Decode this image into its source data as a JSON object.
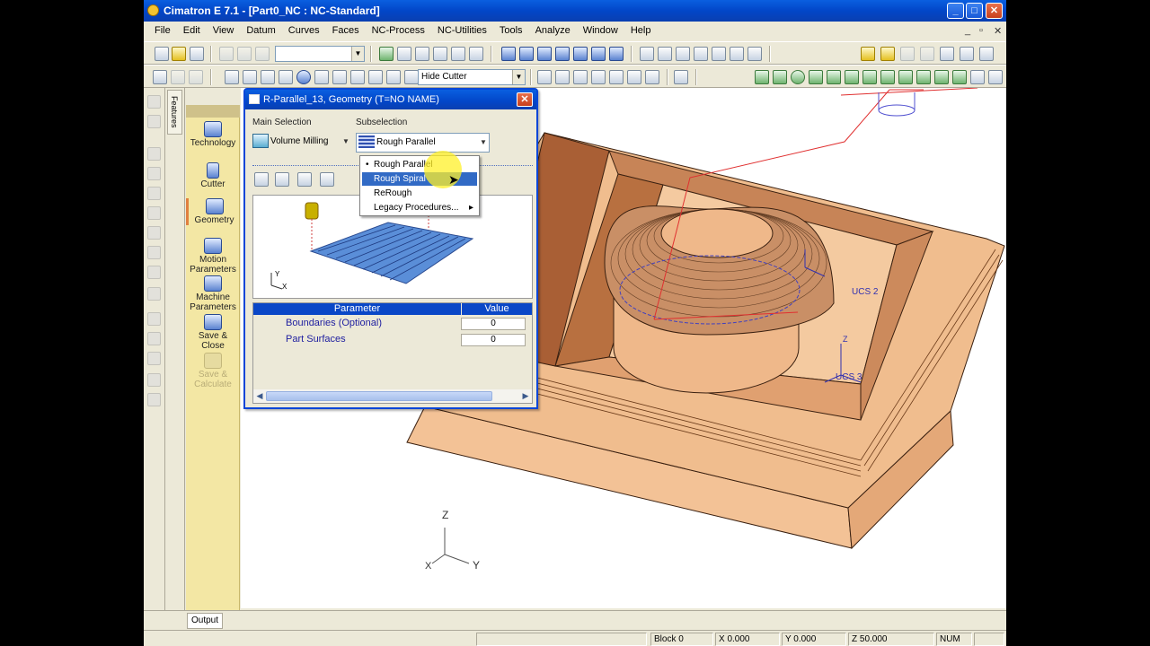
{
  "window": {
    "title": "Cimatron E 7.1 - [Part0_NC : NC-Standard]",
    "min": "_",
    "max": "□",
    "close": "✕"
  },
  "menu": [
    "File",
    "Edit",
    "View",
    "Datum",
    "Curves",
    "Faces",
    "NC-Process",
    "NC-Utilities",
    "Tools",
    "Analyze",
    "Window",
    "Help"
  ],
  "mdi_controls": {
    "min": "_",
    "restore": "▫",
    "close": "✕"
  },
  "toolbar": {
    "hide_cutter": "Hide Cutter"
  },
  "side": {
    "features_tab": "Features"
  },
  "wizard": {
    "technology": "Technology",
    "cutter": "Cutter",
    "geometry": "Geometry",
    "motion": "Motion Parameters",
    "machine": "Machine Parameters",
    "save_close": "Save & Close",
    "save_calc": "Save & Calculate"
  },
  "dialog": {
    "title": "R-Parallel_13, Geometry (T=NO NAME)",
    "close": "✕",
    "main_selection_label": "Main Selection",
    "subselection_label": "Subselection",
    "main_selection_value": "Volume Milling",
    "subselection_value": "Rough Parallel",
    "menu": [
      "Rough Parallel",
      "Rough Spiral",
      "ReRough",
      "Legacy Procedures..."
    ],
    "menu_selected_index": 1,
    "menu_checked_index": 0,
    "preview_axes": {
      "y": "Y",
      "x": "X"
    },
    "table": {
      "headers": [
        "Parameter",
        "Value"
      ],
      "rows": [
        {
          "name": "Boundaries (Optional)",
          "value": "0"
        },
        {
          "name": "Part Surfaces",
          "value": "0"
        }
      ]
    }
  },
  "viewport": {
    "triad": {
      "z": "Z",
      "x": "X",
      "y": "Y"
    },
    "part_labels": {
      "ucs_top": "UCS 2",
      "ucs_bottom": "UCS 3",
      "z": "Z"
    },
    "colors": {
      "part": "#f0bd8e",
      "part_dark": "#b36a3d",
      "edge": "#3a2010",
      "toolpath": "#e03030"
    }
  },
  "output_tab": "Output",
  "status": {
    "block": "Block 0",
    "x": "X 0.000",
    "y": "Y 0.000",
    "z": "Z 50.000",
    "num": "NUM"
  }
}
